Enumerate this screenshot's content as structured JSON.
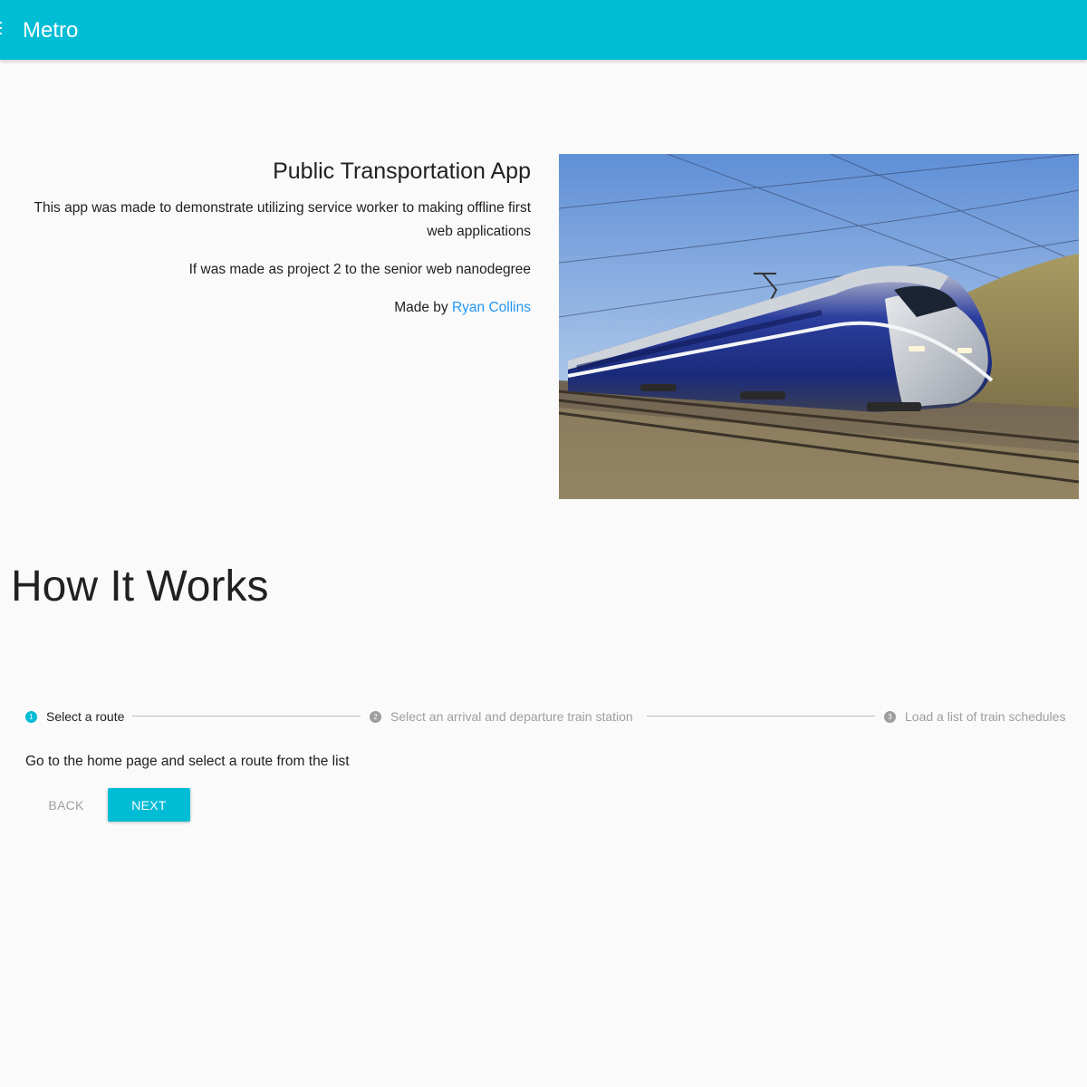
{
  "app": {
    "title": "Metro",
    "menu_icon": "hamburger-menu-icon",
    "accent_color": "#00bcd4",
    "link_color": "#2196f3"
  },
  "intro": {
    "title": "Public Transportation App",
    "paragraph1": "This app was made to demonstrate utilizing service worker to making offline first web applications",
    "paragraph2": "If was made as project 2 to the senior web nanodegree",
    "made_by_prefix": "Made by",
    "author_link": "Ryan Collins"
  },
  "how_it_works": {
    "title": "How It Works",
    "steps": [
      {
        "number": "1",
        "label": "Select a route",
        "active": true
      },
      {
        "number": "2",
        "label": "Select an arrival and departure train station",
        "active": false
      },
      {
        "number": "3",
        "label": "Load a list of train schedules",
        "active": false
      }
    ],
    "step_content": "Go to the home page and select a route from the list",
    "back_label": "BACK",
    "next_label": "NEXT"
  }
}
